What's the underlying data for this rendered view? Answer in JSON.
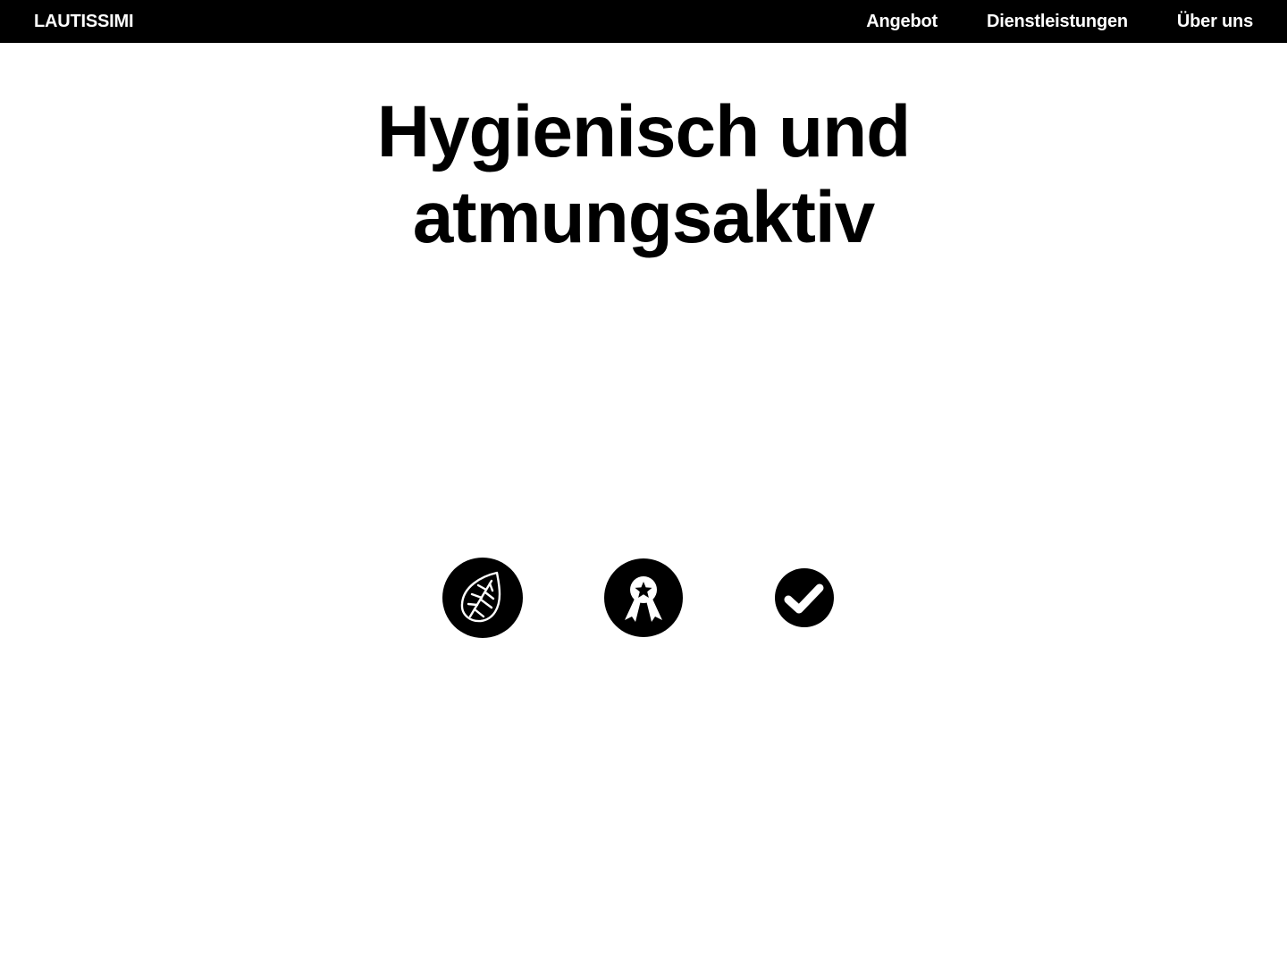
{
  "header": {
    "brand": "LAUTISSIMI",
    "nav": [
      {
        "label": "Angebot"
      },
      {
        "label": "Dienstleistungen"
      },
      {
        "label": "Über uns"
      }
    ]
  },
  "hero": {
    "title_line1": "Hygienisch und",
    "title_line2": "atmungsaktiv"
  },
  "badges": [
    {
      "icon": "leaf-icon"
    },
    {
      "icon": "award-ribbon-icon"
    },
    {
      "icon": "checkmark-icon"
    }
  ],
  "colors": {
    "header_bg": "#000000",
    "header_text": "#ffffff",
    "page_bg": "#ffffff",
    "text": "#000000"
  }
}
